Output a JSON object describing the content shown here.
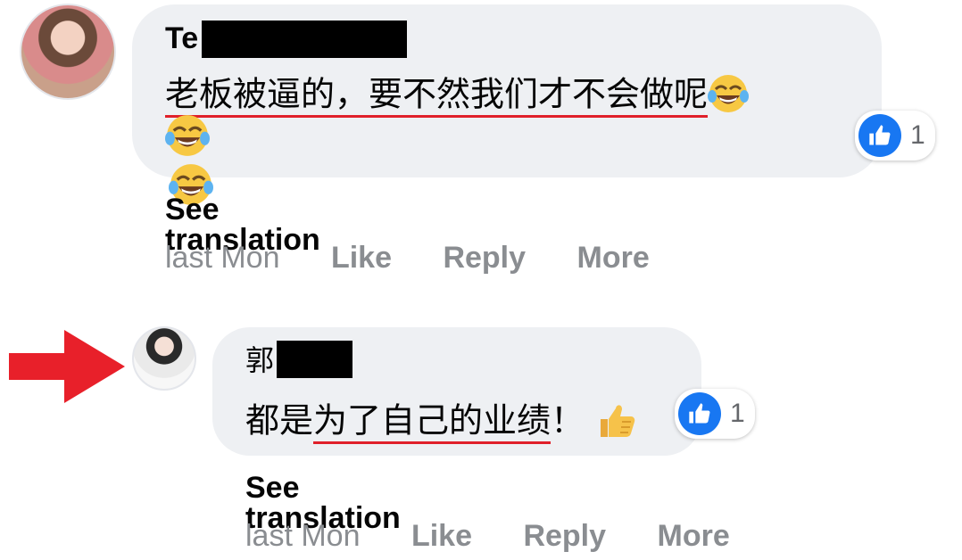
{
  "comments": [
    {
      "author_visible": "Te",
      "text_underlined": "老板被逼的，要不然我们才不会做呢",
      "text_trailing": "",
      "reaction_count": "1",
      "see_translation": "See translation",
      "time": "last Mon",
      "like_label": "Like",
      "reply_label": "Reply",
      "more_label": "More"
    },
    {
      "author_visible": "郭",
      "text_prefix": "都是",
      "text_underlined": "为了自己的业绩",
      "text_trailing": "！",
      "reaction_count": "1",
      "see_translation": "See translation",
      "time": "last Mon",
      "like_label": "Like",
      "reply_label": "Reply",
      "more_label": "More"
    }
  ],
  "colors": {
    "bubble": "#eef0f3",
    "like_blue": "#1877f2",
    "meta_gray": "#8a8d91",
    "underline_red": "#e0202a",
    "arrow_red": "#e8202a"
  },
  "icons": {
    "reaction": "thumbs-up-icon",
    "emoji_laugh": "tears-of-joy-emoji",
    "emoji_thumb": "thumbs-up-emoji",
    "pointer": "red-arrow-icon"
  }
}
